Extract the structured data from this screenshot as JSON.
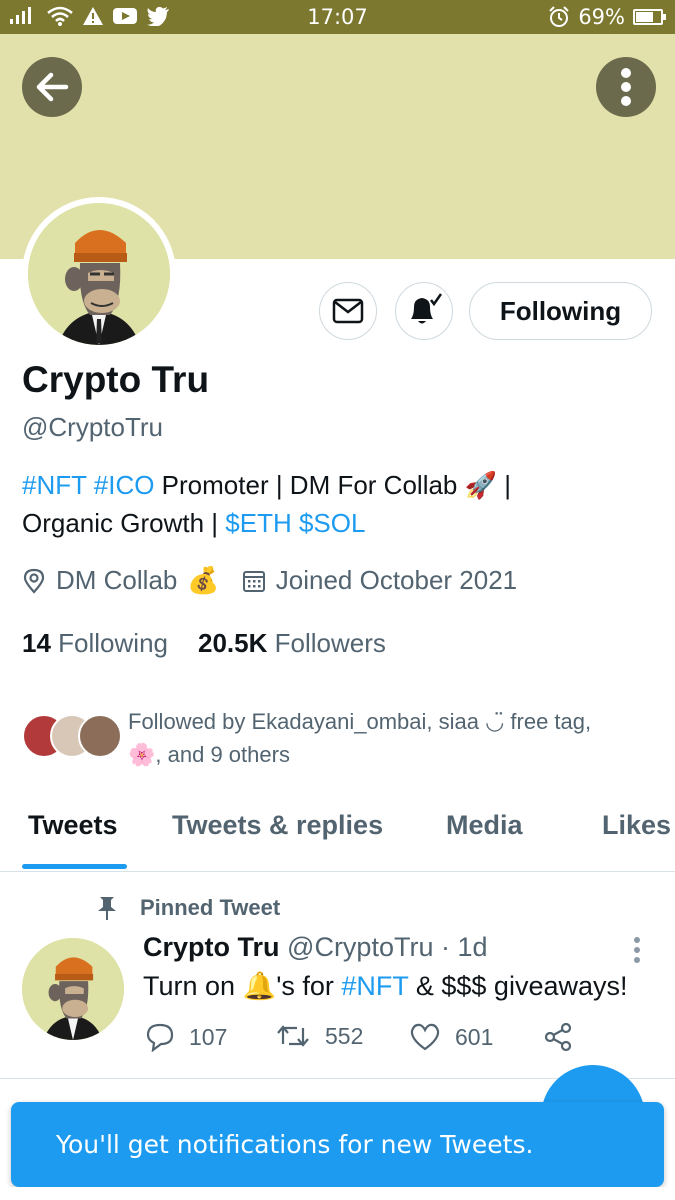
{
  "status_bar": {
    "left_icons": [
      "signal-icon",
      "wifi-icon",
      "alert-icon",
      "youtube-icon",
      "twitter-icon"
    ],
    "time": "17:07",
    "battery_percent": "69%",
    "battery_level": 0.69
  },
  "colors": {
    "accent": "#1d9bf0",
    "banner": "#e2e1ab",
    "status_bar": "#7c7830",
    "secondary_text": "#536471"
  },
  "profile": {
    "name": "Crypto Tru",
    "handle": "@CryptoTru",
    "bio": {
      "tag_nft": "#NFT",
      "tag_ico": "#ICO",
      "text_1": " Promoter | DM For Collab ",
      "emoji_rocket": "🚀",
      "text_2": " |",
      "text_3": "Organic Growth | ",
      "cash_eth": "$ETH",
      "cash_sol": "$SOL"
    },
    "location": "DM Collab",
    "location_emoji": "💰",
    "joined": "Joined October 2021",
    "following_count": "14",
    "following_label": "Following",
    "followers_count": "20.5K",
    "followers_label": "Followers",
    "followed_by": {
      "text_1": "Followed by Ekadayani_ombai, siaa ◡̈ free tag,",
      "emoji": "🌸",
      "text_2": ", and 9 others"
    },
    "follow_button_label": "Following"
  },
  "tabs": [
    {
      "label": "Tweets",
      "active": true
    },
    {
      "label": "Tweets & replies",
      "active": false
    },
    {
      "label": "Media",
      "active": false
    },
    {
      "label": "Likes",
      "active": false
    }
  ],
  "pinned_tweet": {
    "pinned_label": "Pinned Tweet",
    "author_name": "Crypto Tru",
    "author_handle": "@CryptoTru",
    "time": " · 1d",
    "text_1": "Turn on ",
    "emoji_bell": "🔔",
    "text_2": "'s for ",
    "tag": "#NFT",
    "text_3": " & $$$ giveaways!",
    "replies": "107",
    "retweets": "552",
    "likes": "601"
  },
  "toast": {
    "message": "You'll get notifications for new Tweets."
  }
}
